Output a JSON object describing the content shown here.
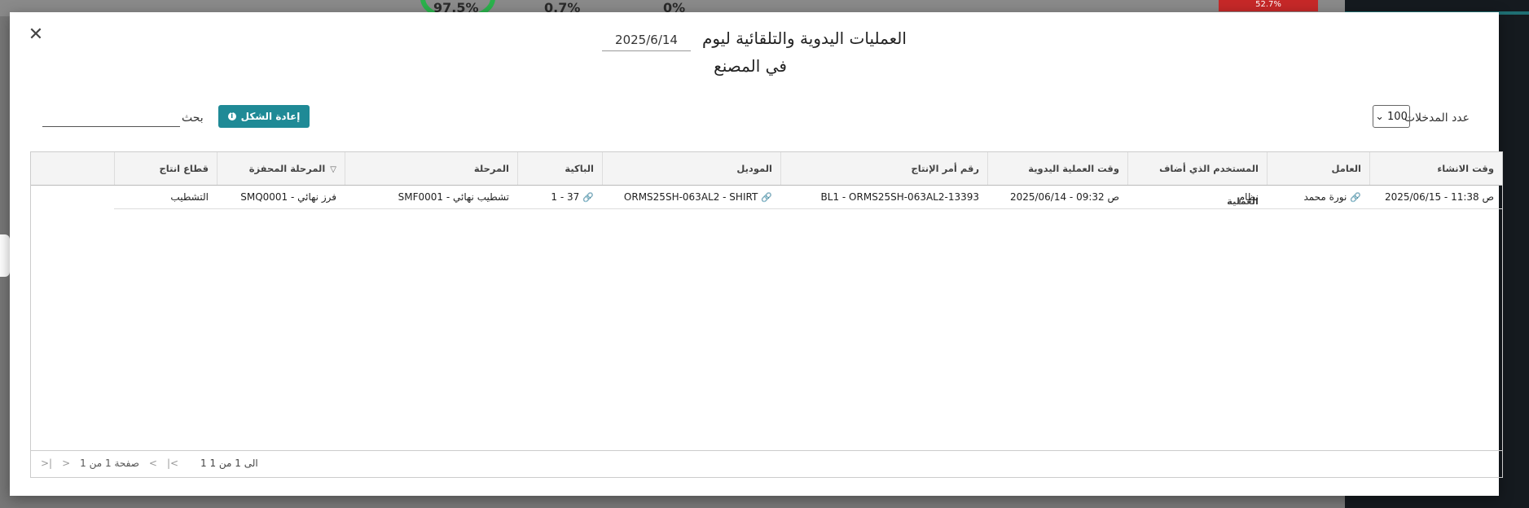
{
  "background": {
    "badges": [
      "97.5%",
      "0.7%",
      "0%"
    ],
    "red_bar": "52.7%"
  },
  "modal": {
    "title": "العمليات اليدوية والتلقائية ليوم",
    "date_value": "2025/6/14",
    "subtitle": "في  المصنع",
    "close_icon": "close-icon"
  },
  "controls": {
    "entries_label": "عدد المدخلات",
    "entries_value": "100",
    "reset_label": "إعادة الشكل",
    "search_label": "بحث",
    "search_value": ""
  },
  "table": {
    "headers": {
      "created_at": "وقت الانشاء",
      "worker": "العامل",
      "added_by": "المستخدم الذي أضاف العملية",
      "manual_time": "وقت العملية اليدوية",
      "production_order": "رقم أمر الإنتاج",
      "model": "الموديل",
      "bundle": "الباكية",
      "stage": "المرحلة",
      "triggered_stage": "المرحلة المحفزة",
      "sector": "قطاع انتاج"
    },
    "rows": [
      {
        "created_at": "2025/06/15 - 11:38 ص",
        "worker": "نورة محمد",
        "added_by": "نظام",
        "manual_time": "2025/06/14 - 09:32 ص",
        "production_order": "BL1 - ORMS25SH-063AL2-13393",
        "model": "ORMS25SH-063AL2 - SHIRT",
        "bundle": "1 - 37",
        "stage": "SMF0001 - تشطيب نهائي",
        "triggered_stage": "SMQ0001 - فرز نهائي",
        "sector": "التشطيب"
      }
    ]
  },
  "footer": {
    "page_text": "صفحة 1 من 1",
    "count_text": "1 الى 1 من 1"
  }
}
